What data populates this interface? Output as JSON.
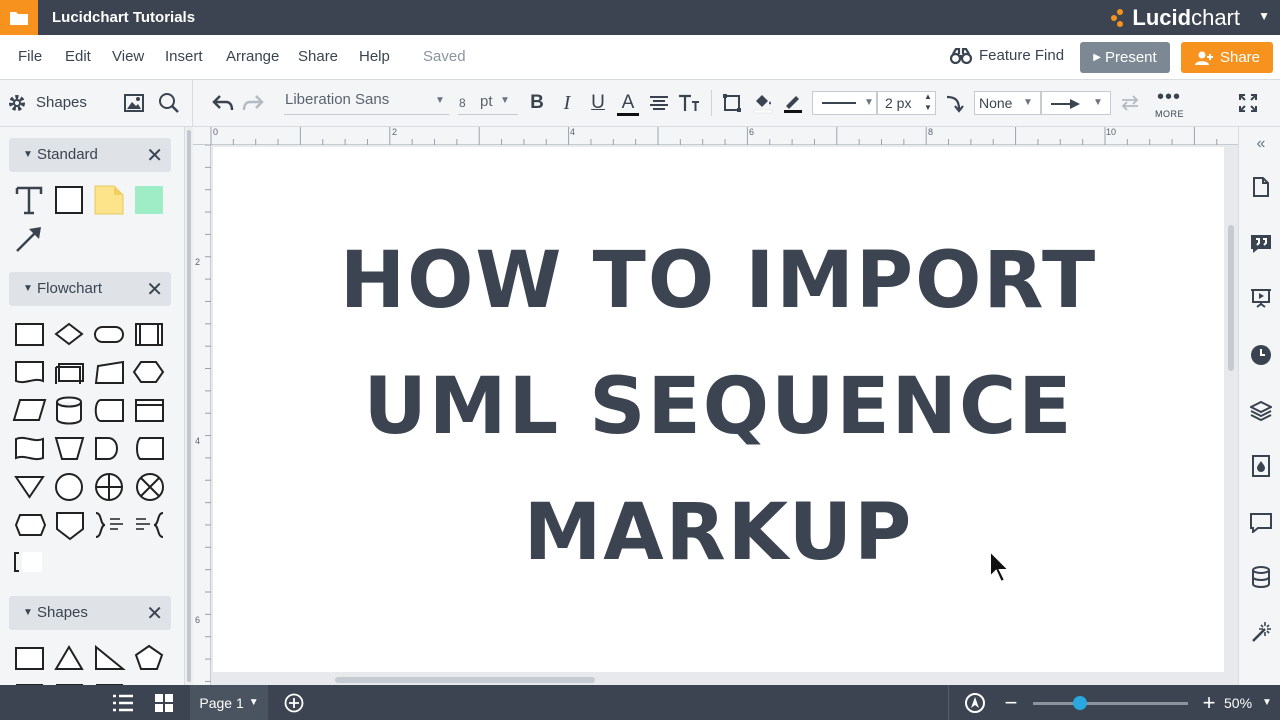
{
  "app": {
    "document_title": "Lucidchart Tutorials",
    "brand_prefix": "Lucid",
    "brand_suffix": "chart"
  },
  "menu": {
    "items": [
      "File",
      "Edit",
      "View",
      "Insert",
      "Arrange",
      "Share",
      "Help"
    ],
    "status": "Saved",
    "feature_find": "Feature Find",
    "present": "Present",
    "share": "Share"
  },
  "toolbar": {
    "shapes_label": "Shapes",
    "font_family": "Liberation Sans",
    "font_size": "8",
    "font_unit": "pt",
    "line_width": "2 px",
    "arrow_start": "None",
    "more_label": "MORE"
  },
  "left_panel": {
    "sections": [
      {
        "title": "Standard"
      },
      {
        "title": "Flowchart"
      },
      {
        "title": "Shapes"
      }
    ]
  },
  "rulers": {
    "horizontal": [
      "0",
      "2",
      "4",
      "6",
      "8",
      "10"
    ],
    "vertical": [
      "2",
      "4",
      "6"
    ]
  },
  "canvas": {
    "lines": [
      "HOW TO IMPORT",
      "UML SEQUENCE",
      "MARKUP"
    ]
  },
  "bottom": {
    "page_label": "Page 1",
    "zoom": "50%",
    "zoom_level_fraction": 0.3
  },
  "colors": {
    "header_bg": "#3b4450",
    "accent_orange": "#f7921e",
    "present_gray": "#7c8894",
    "zoom_blue": "#29a8e0"
  }
}
